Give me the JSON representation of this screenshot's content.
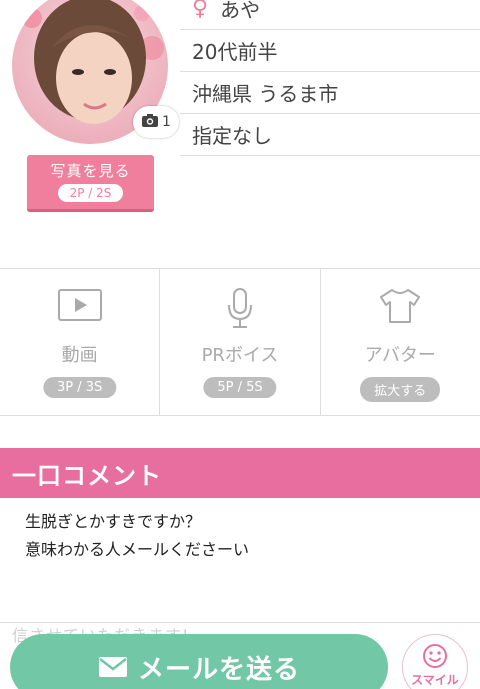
{
  "profile": {
    "name": "あや",
    "age": "20代前半",
    "location": "沖縄県 うるま市",
    "attribute": "指定なし",
    "photo_count": "1",
    "view_photo_label": "写真を見る",
    "view_photo_cost": "2P / 2S"
  },
  "features": [
    {
      "label": "動画",
      "badge": "3P / 3S",
      "icon": "play-icon"
    },
    {
      "label": "PRボイス",
      "badge": "5P / 5S",
      "icon": "microphone-icon"
    },
    {
      "label": "アバター",
      "badge": "拡大する",
      "icon": "tshirt-icon"
    }
  ],
  "comment": {
    "heading": "一口コメント",
    "lines": [
      "生脱ぎとかすきですか？",
      "意味わかる人メールくださーい"
    ]
  },
  "faded_text": "信させていただきます!",
  "actions": {
    "mail_label": "メールを送る",
    "smile_label": "スマイル"
  },
  "colors": {
    "accent_pink": "#e86ea0",
    "mail_green": "#72c7a6",
    "badge_gray": "#bdbdbd"
  }
}
